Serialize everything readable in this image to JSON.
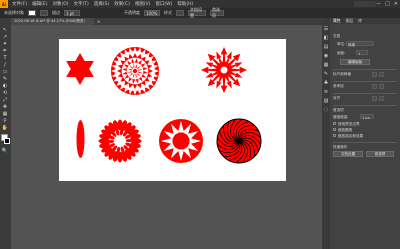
{
  "titlebar": {
    "app_logo": "Ai",
    "menu": [
      "文件(F)",
      "编辑(E)",
      "对象(O)",
      "文字(T)",
      "选择(S)",
      "效果(C)",
      "视图(V)",
      "窗口(W)",
      "帮助(H)"
    ],
    "window_buttons": [
      "—",
      "□",
      "✕"
    ]
  },
  "control": {
    "selection_label": "未选择对象",
    "stroke_label": "描边",
    "stroke_width": "1 pt",
    "opacity_label": "不透明度",
    "opacity_value": "100%",
    "style_label": "样式",
    "doc_setup_label": "文档设置",
    "prefs_label": "首选项"
  },
  "document": {
    "tab_title": "2020.08.18 #.Ai* @ 44.17% (RGB/预览)",
    "tab_close": "×"
  },
  "tools": [
    "↖",
    "↗",
    "✦",
    "✒",
    "T",
    "/",
    "▭",
    "✎",
    "◐",
    "⟲",
    "⤢",
    "✥",
    "▦",
    "⚲",
    "✋",
    "🔍"
  ],
  "artwork": {
    "fill_color": "#ff0000",
    "dark_color": "#000000",
    "artboard_color": "#ffffff"
  },
  "panel": {
    "tabs": [
      "属性",
      "图层",
      "库"
    ],
    "active_tab": "属性",
    "section_document": "文档",
    "units_label": "单位:",
    "units_value": "像素",
    "artboard_label": "画板:",
    "artboard_value": "1",
    "edit_artboards_button": "编辑画板",
    "ruler_grid_label": "标尺和网格",
    "guides_label": "参考线",
    "align_label": "对齐",
    "prefs_section": "首选项",
    "keyboard_increment_label": "键盘增量:",
    "keyboard_increment_value": "1 px",
    "check_1": "使用预览边界",
    "check_2": "缩放圆角",
    "check_3": "缩放描边和效果",
    "quick_actions_label": "快速操作",
    "doc_setup_button": "文档设置",
    "preferences_button": "首选项"
  }
}
